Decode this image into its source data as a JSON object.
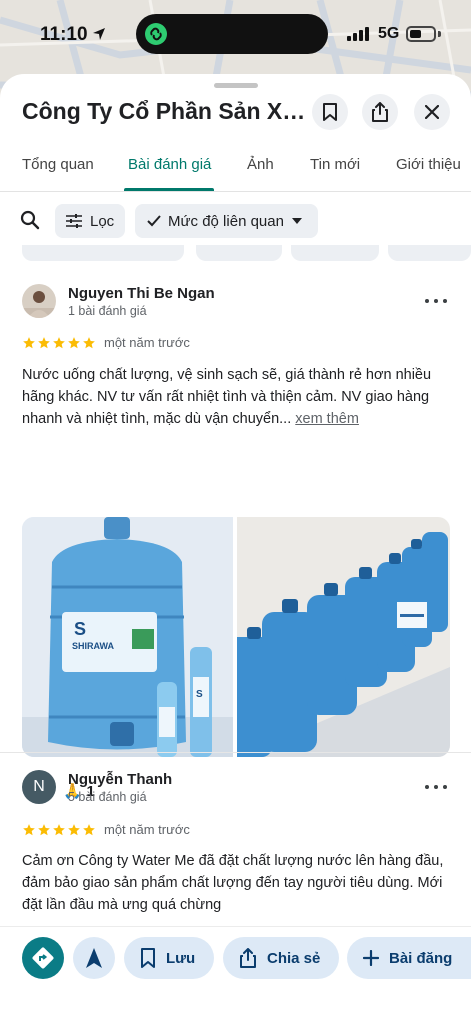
{
  "status_bar": {
    "time": "11:10",
    "network": "5G",
    "battery_level": 0.5
  },
  "place": {
    "title": "Công Ty Cổ Phần Sản Xu..."
  },
  "tabs": [
    {
      "label": "Tổng quan"
    },
    {
      "label": "Bài đánh giá",
      "active": true
    },
    {
      "label": "Ảnh"
    },
    {
      "label": "Tin mới"
    },
    {
      "label": "Giới thiệu"
    }
  ],
  "filters": {
    "filter_label": "Lọc",
    "sort_label": "Mức độ liên quan"
  },
  "reviews": [
    {
      "author": "Nguyen Thi Be Ngan",
      "review_count": "1 bài đánh giá",
      "rating": 5,
      "when": "một năm trước",
      "text": "Nước uống chất lượng, vệ sinh sạch sẽ, giá thành rẻ hơn nhiều hãng khác. NV tư vấn rất nhiệt tình và thiện cảm. NV giao hàng nhanh và nhiệt tình, mặc dù vận chuyển...",
      "see_more": "xem thêm",
      "photo_brand": "SHIRAWA",
      "reaction_emoji": "🙏",
      "reaction_count": "1"
    },
    {
      "author": "Nguyễn Thanh",
      "initial": "N",
      "review_count": "5 bài đánh giá",
      "rating": 5,
      "when": "một năm trước",
      "text": "Cảm ơn Công ty Water Me đã đặt chất lượng nước lên hàng đầu, đảm bảo giao sản phẩm chất lượng đến tay người tiêu dùng. Mới đặt lần đầu mà ưng quá chừng"
    }
  ],
  "bottom_bar": {
    "save_label": "Lưu",
    "share_label": "Chia sẻ",
    "post_label": "Bài đăng"
  },
  "colors": {
    "accent": "#00796b",
    "star": "#fbbc04",
    "pill_bg": "#dde9f6",
    "directions": "#0b7c86"
  }
}
